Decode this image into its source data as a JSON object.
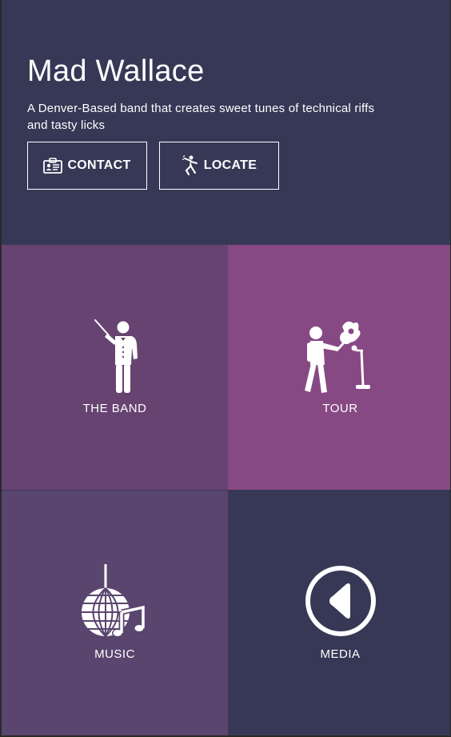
{
  "hero": {
    "title": "Mad Wallace",
    "subtitle": "A Denver-Based band that creates sweet tunes of technical riffs and tasty licks",
    "buttons": [
      {
        "label": "CONTACT",
        "icon": "id-card-icon"
      },
      {
        "label": "LOCATE",
        "icon": "dancer-icon"
      }
    ]
  },
  "tiles": [
    {
      "label": "THE BAND",
      "icon": "conductor-icon",
      "color": "#674371"
    },
    {
      "label": "TOUR",
      "icon": "performer-icon",
      "color": "#874984"
    },
    {
      "label": "MUSIC",
      "icon": "disco-ball-icon",
      "color": "#5a456f"
    },
    {
      "label": "MEDIA",
      "icon": "play-back-icon",
      "color": "#373856"
    }
  ],
  "colors": {
    "hero_background": "#373856",
    "text": "#ffffff"
  }
}
